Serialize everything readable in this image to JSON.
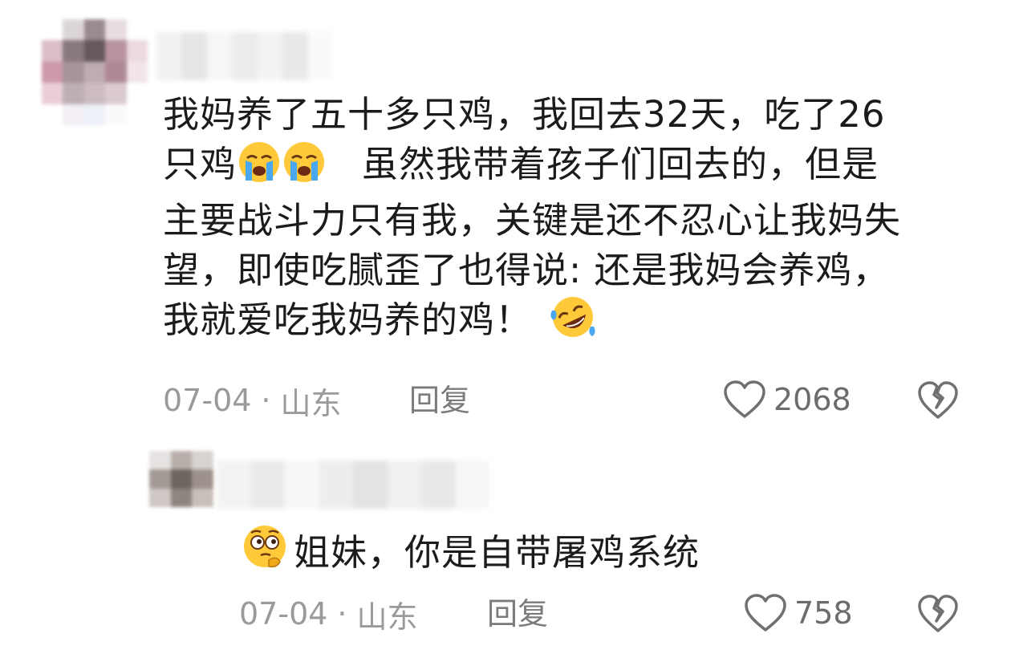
{
  "comment": {
    "author_avatar_icon": "blurred-avatar",
    "text_lines": [
      "我妈养了五十多只鸡，我回去32天，吃了26",
      "只鸡",
      "虽然我带着孩子们回去的，但是",
      "主要战斗力只有我，关键是还不忍心让我妈失",
      "望，即使吃腻歪了也得说: 还是我妈会养鸡，",
      "我就爱吃我妈养的鸡！"
    ],
    "emojis": [
      "crying-face-icon",
      "crying-face-icon",
      "rolling-laughing-icon"
    ],
    "date": "07-04",
    "dot": "·",
    "location": "山东",
    "reply_label": "回复",
    "like_count": "2068"
  },
  "reply": {
    "author_avatar_icon": "blurred-avatar",
    "emoji": "thinking-face-icon",
    "text": "姐妹，你是自带屠鸡系统",
    "date": "07-04",
    "dot": "·",
    "location": "山东",
    "reply_label": "回复",
    "like_count": "758"
  },
  "colors": {
    "text": "#1b1b1b",
    "meta": "#9a9a9a",
    "icon": "#707070"
  }
}
